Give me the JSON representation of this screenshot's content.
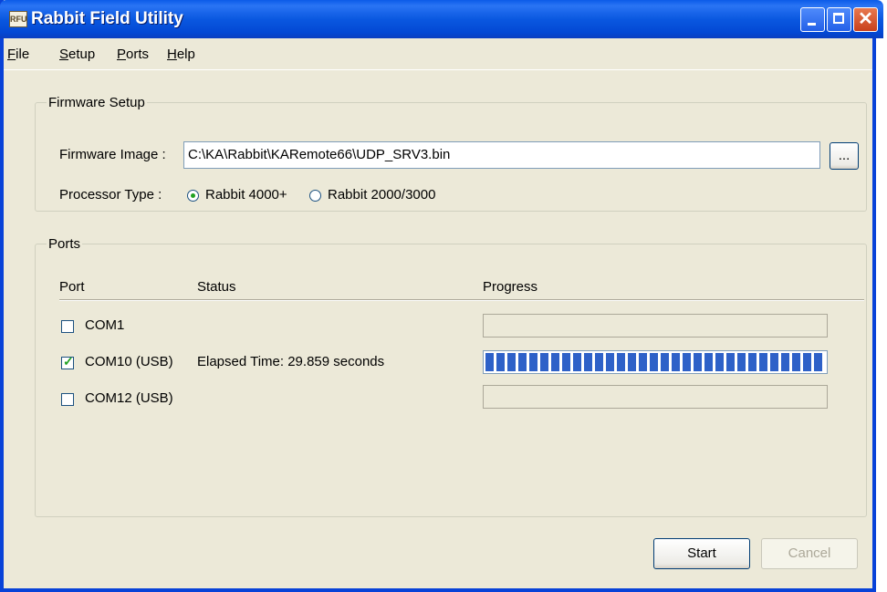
{
  "window": {
    "title": "Rabbit Field Utility",
    "app_icon": "rabbit-app-icon"
  },
  "menu": [
    "File",
    "Setup",
    "Ports",
    "Help"
  ],
  "firmware_setup": {
    "legend": "Firmware Setup",
    "image_label": "Firmware Image :",
    "image_path": "C:\\KA\\Rabbit\\KARemote66\\UDP_SRV3.bin",
    "browse_label": "...",
    "processor_label": "Processor Type :",
    "processor_options": [
      {
        "label": "Rabbit 4000+",
        "selected": true
      },
      {
        "label": "Rabbit 2000/3000",
        "selected": false
      }
    ]
  },
  "ports": {
    "legend": "Ports",
    "headers": {
      "port": "Port",
      "status": "Status",
      "progress": "Progress"
    },
    "rows": [
      {
        "port": "COM1",
        "checked": false,
        "status": "",
        "progress": 0
      },
      {
        "port": "COM10 (USB)",
        "checked": true,
        "status": "Elapsed Time: 29.859 seconds",
        "progress": 1.0
      },
      {
        "port": "COM12 (USB)",
        "checked": false,
        "status": "",
        "progress": 0
      }
    ]
  },
  "buttons": {
    "start": "Start",
    "cancel": "Cancel",
    "cancel_enabled": false
  },
  "colors": {
    "titlebar": "#0A58E0",
    "progress_fill": "#2E61C8",
    "face": "#ECE9D8"
  }
}
